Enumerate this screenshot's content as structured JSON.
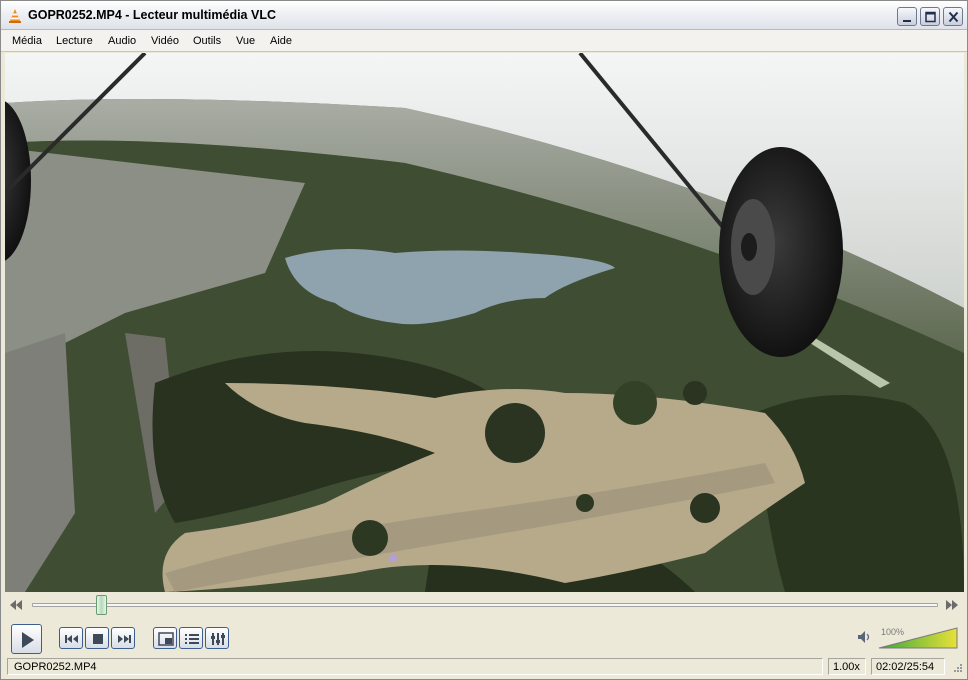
{
  "window": {
    "title": "GOPR0252.MP4 - Lecteur multimédia VLC",
    "icon": "vlc-cone-icon"
  },
  "menu": {
    "items": [
      {
        "label": "Média"
      },
      {
        "label": "Lecture"
      },
      {
        "label": "Audio"
      },
      {
        "label": "Vidéo"
      },
      {
        "label": "Outils"
      },
      {
        "label": "Vue"
      },
      {
        "label": "Aide"
      }
    ]
  },
  "video": {
    "content": "aerial-park-footage"
  },
  "playback": {
    "progress": 0.077,
    "state": "paused"
  },
  "volume": {
    "label": "100%",
    "level": 1.0
  },
  "status": {
    "file": "GOPR0252.MP4",
    "rate": "1.00x",
    "time": "02:02/25:54"
  },
  "colors": {
    "accent": "#3d5f8f",
    "volume_low": "#3aa83a",
    "volume_high": "#e8e03a"
  }
}
